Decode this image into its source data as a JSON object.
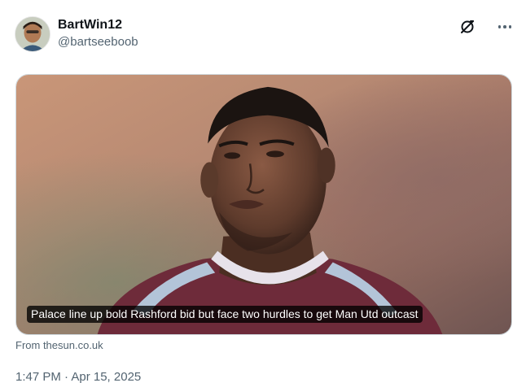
{
  "tweet": {
    "author": {
      "display_name": "BartWin12",
      "handle": "@bartseeboob"
    },
    "icons": [
      "grok-icon",
      "more-icon"
    ],
    "card": {
      "headline": "Palace line up bold Rashford bid but face two hurdles to get Man Utd outcast",
      "source": "From thesun.co.uk"
    },
    "timestamp": "1:47 PM · Apr 15, 2025"
  },
  "colors": {
    "text_primary": "#0f1419",
    "text_secondary": "#536471",
    "border": "#cfd9de",
    "caption_bg": "#000000",
    "jersey": "#6e2b3a"
  }
}
